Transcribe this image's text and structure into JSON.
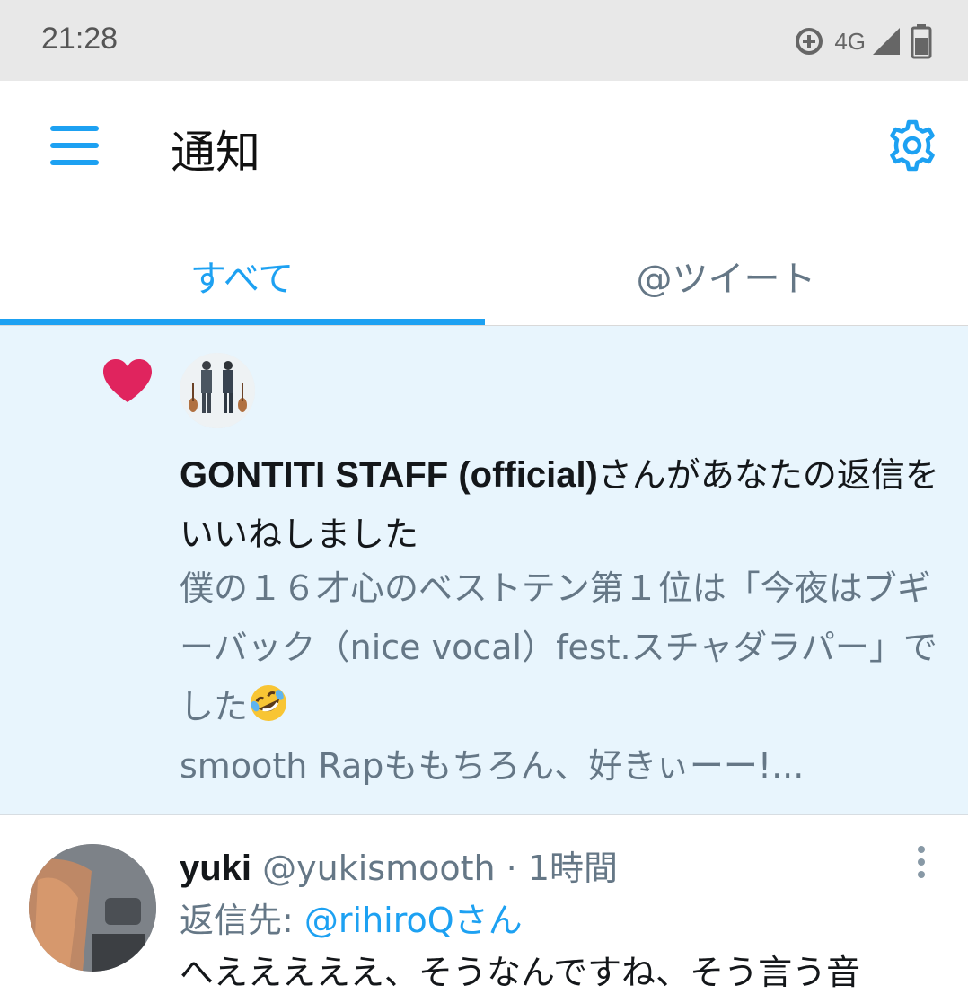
{
  "status_bar": {
    "time": "21:28",
    "network": "4G",
    "icons": [
      "data-saver-icon",
      "signal-icon",
      "battery-icon"
    ]
  },
  "header": {
    "title": "通知",
    "menu_icon": "hamburger-menu-icon",
    "settings_icon": "gear-icon"
  },
  "tabs": [
    {
      "label": "すべて",
      "active": true
    },
    {
      "label": "@ツイート",
      "active": false
    }
  ],
  "notification": {
    "icon": "heart-icon",
    "actor_name": "GONTITI STAFF (official)",
    "action_text": "さんがあなたの返信をいいねしました",
    "quoted_text": "僕の１６才心のベストテン第１位は「今夜はブギーバック（nice vocal）fest.スチャダラパー」でした",
    "quoted_emoji": "rolling-on-floor-laughing-emoji",
    "quoted_text_line2": "smooth Rapももちろん、好きぃーー!..."
  },
  "tweet": {
    "name": "yuki",
    "handle": "@yukismooth",
    "separator": "·",
    "time": "1時間",
    "reply_prefix": "返信先: ",
    "reply_to": "@rihiroQさん",
    "body": "へえええええ、そうなんですね、そう言う音"
  },
  "colors": {
    "accent": "#1da1f2",
    "like": "#e0245e",
    "highlight_bg": "#e8f5fd",
    "secondary_text": "#657786"
  }
}
